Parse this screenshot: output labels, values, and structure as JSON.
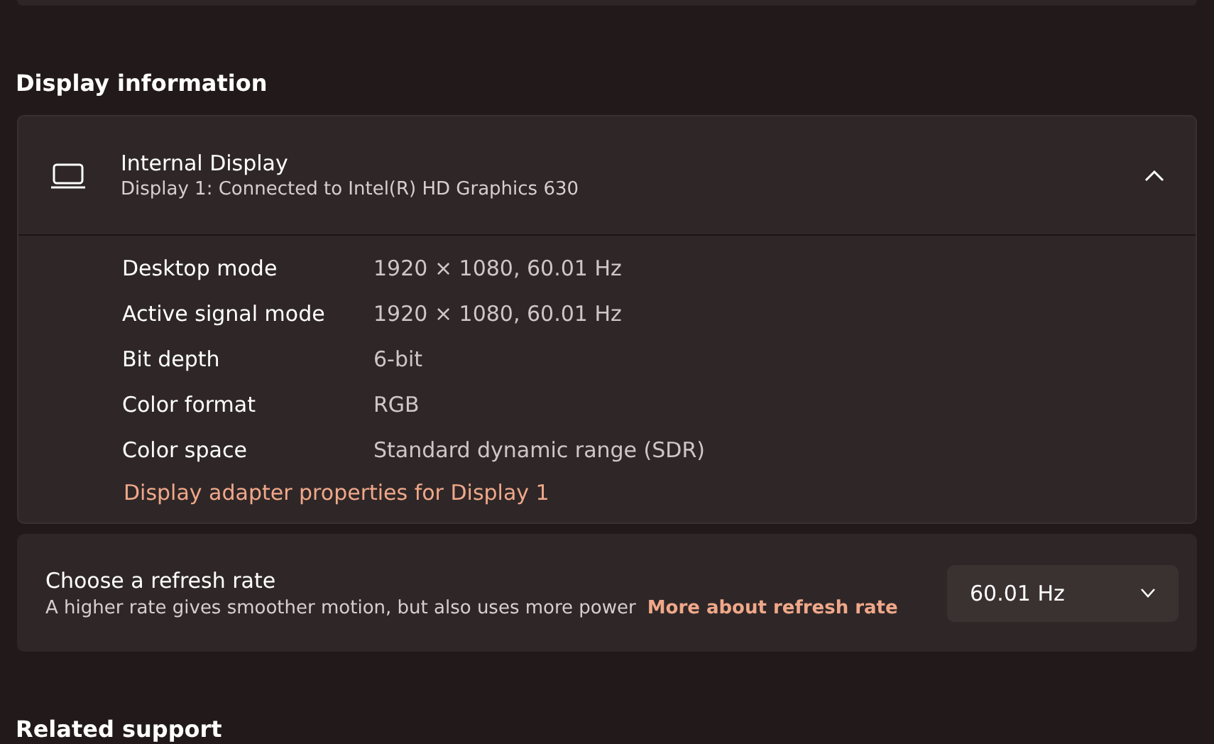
{
  "section_title": "Display information",
  "display": {
    "title": "Internal Display",
    "subtitle": "Display 1: Connected to Intel(R) HD Graphics 630",
    "expanded": true,
    "properties": [
      {
        "label": "Desktop mode",
        "value": "1920 × 1080, 60.01 Hz"
      },
      {
        "label": "Active signal mode",
        "value": "1920 × 1080, 60.01 Hz"
      },
      {
        "label": "Bit depth",
        "value": "6-bit"
      },
      {
        "label": "Color format",
        "value": "RGB"
      },
      {
        "label": "Color space",
        "value": "Standard dynamic range (SDR)"
      }
    ],
    "link": "Display adapter properties for Display 1"
  },
  "refresh": {
    "title": "Choose a refresh rate",
    "description": "A higher rate gives smoother motion, but also uses more power",
    "link": "More about refresh rate",
    "dropdown": {
      "value": "60.01 Hz"
    }
  },
  "next_section_title": "Related support"
}
